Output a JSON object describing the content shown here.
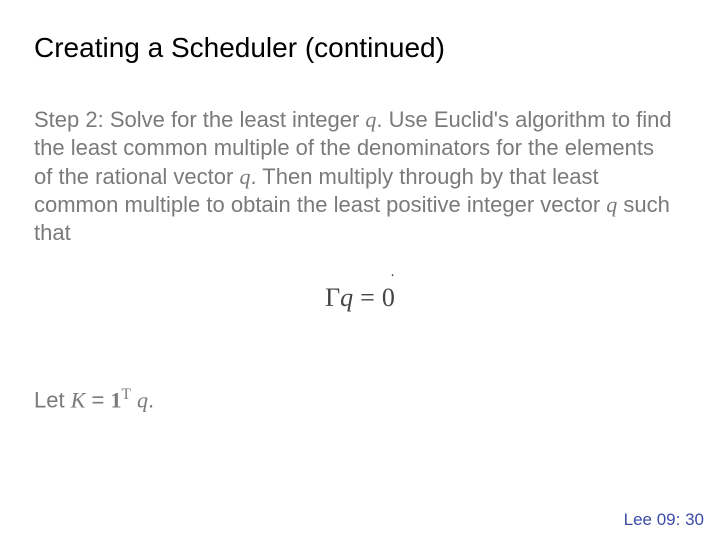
{
  "slide": {
    "title": "Creating a Scheduler (continued)",
    "body_pre": "Step 2: Solve for the least integer ",
    "body_var1": "q",
    "body_mid1": ". Use Euclid's algorithm to find the least common multiple of the denominators for the elements of the rational vector ",
    "body_var2": "q",
    "body_mid2": ". Then multiply through by that least common multiple to obtain the least positive integer vector ",
    "body_var3": "q",
    "body_end": " such that",
    "equation": {
      "gamma": "Γ",
      "q": "q",
      "equals": "=",
      "zero": "0",
      "vec_mark": "ॱ"
    },
    "let": {
      "pre": "Let ",
      "K": "K",
      "eq": " = ",
      "one": "1",
      "T": "T",
      "space": " ",
      "q": "q",
      "period": "."
    },
    "footer": "Lee 09: 30"
  }
}
